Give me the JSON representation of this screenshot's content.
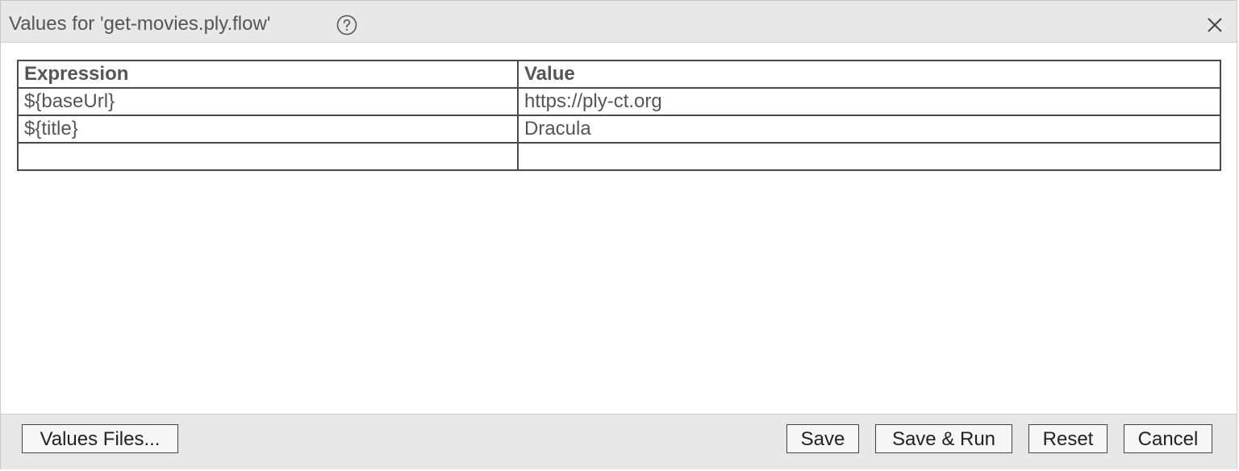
{
  "dialog": {
    "title": "Values for 'get-movies.ply.flow'",
    "help_icon": "question-circle-icon",
    "close_icon": "close-x-icon"
  },
  "table": {
    "headers": [
      "Expression",
      "Value"
    ],
    "rows": [
      [
        "${baseUrl}",
        "https://ply-ct.org"
      ],
      [
        "${title}",
        "Dracula"
      ],
      [
        "",
        ""
      ]
    ]
  },
  "footer": {
    "values_files_label": "Values Files...",
    "save_label": "Save",
    "save_run_label": "Save & Run",
    "reset_label": "Reset",
    "cancel_label": "Cancel"
  },
  "colors": {
    "titlebar_bg": "#e8e8e8",
    "footer_bg": "#e8e8e8",
    "text": "#555555",
    "border": "#4a4a4a"
  }
}
